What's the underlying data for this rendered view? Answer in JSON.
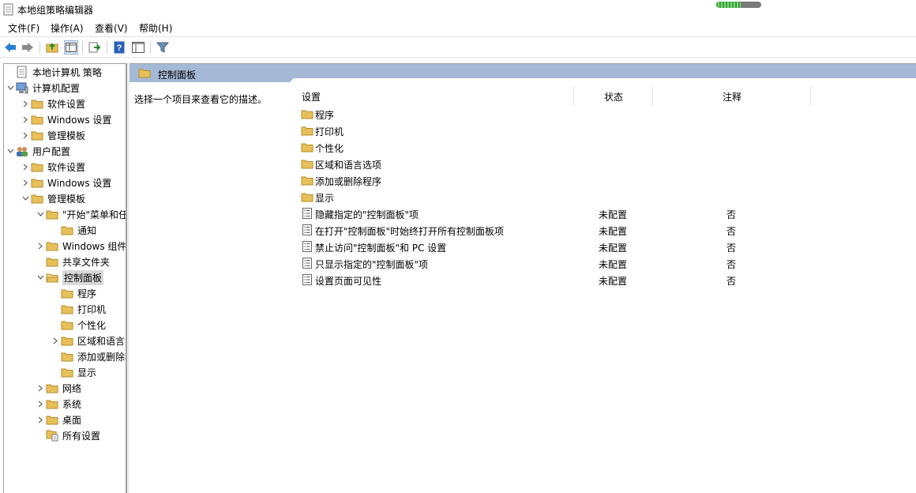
{
  "window": {
    "title": "本地组策略编辑器",
    "progress": 0.55
  },
  "menu": [
    {
      "label": "文件(F)"
    },
    {
      "label": "操作(A)"
    },
    {
      "label": "查看(V)"
    },
    {
      "label": "帮助(H)"
    }
  ],
  "toolbar": {
    "buttons": [
      "back-icon",
      "forward-icon",
      "up-folder-icon",
      "show-hide-tree-icon",
      "export-list-icon",
      "help-icon",
      "properties-icon",
      "filter-icon"
    ]
  },
  "tree": [
    {
      "label": "本地计算机 策略",
      "icon": "policy-icon",
      "chev": ""
    },
    {
      "label": "计算机配置",
      "icon": "computer-icon",
      "chev": "v"
    },
    {
      "label": "软件设置",
      "icon": "folder-icon",
      "chev": ">"
    },
    {
      "label": "Windows 设置",
      "icon": "folder-icon",
      "chev": ">"
    },
    {
      "label": "管理模板",
      "icon": "folder-icon",
      "chev": ">"
    },
    {
      "label": "用户配置",
      "icon": "users-icon",
      "chev": "v"
    },
    {
      "label": "软件设置",
      "icon": "folder-icon",
      "chev": ">"
    },
    {
      "label": "Windows 设置",
      "icon": "folder-icon",
      "chev": ">"
    },
    {
      "label": "管理模板",
      "icon": "folder-icon",
      "chev": "v"
    },
    {
      "label": "\"开始\"菜单和任务栏",
      "icon": "folder-icon",
      "chev": "v"
    },
    {
      "label": "通知",
      "icon": "folder-icon",
      "chev": ""
    },
    {
      "label": "Windows 组件",
      "icon": "folder-icon",
      "chev": ">"
    },
    {
      "label": "共享文件夹",
      "icon": "folder-icon",
      "chev": ""
    },
    {
      "label": "控制面板",
      "icon": "folder-open-icon",
      "chev": "v"
    },
    {
      "label": "程序",
      "icon": "folder-icon",
      "chev": ""
    },
    {
      "label": "打印机",
      "icon": "folder-icon",
      "chev": ""
    },
    {
      "label": "个性化",
      "icon": "folder-icon",
      "chev": ""
    },
    {
      "label": "区域和语言选项",
      "icon": "folder-icon",
      "chev": ">"
    },
    {
      "label": "添加或删除程序",
      "icon": "folder-icon",
      "chev": ""
    },
    {
      "label": "显示",
      "icon": "folder-icon",
      "chev": ""
    },
    {
      "label": "网络",
      "icon": "folder-icon",
      "chev": ">"
    },
    {
      "label": "系统",
      "icon": "folder-icon",
      "chev": ">"
    },
    {
      "label": "桌面",
      "icon": "folder-icon",
      "chev": ">"
    },
    {
      "label": "所有设置",
      "icon": "all-settings-icon",
      "chev": ""
    }
  ],
  "right": {
    "header_title": "控制面板",
    "description": "选择一个项目来查看它的描述。",
    "columns": {
      "setting": "设置",
      "state": "状态",
      "note": "注释"
    },
    "rows": [
      {
        "name": "程序",
        "state": "",
        "note": "",
        "icon": "folder-icon"
      },
      {
        "name": "打印机",
        "state": "",
        "note": "",
        "icon": "folder-icon"
      },
      {
        "name": "个性化",
        "state": "",
        "note": "",
        "icon": "folder-icon"
      },
      {
        "name": "区域和语言选项",
        "state": "",
        "note": "",
        "icon": "folder-icon"
      },
      {
        "name": "添加或删除程序",
        "state": "",
        "note": "",
        "icon": "folder-icon"
      },
      {
        "name": "显示",
        "state": "",
        "note": "",
        "icon": "folder-icon"
      },
      {
        "name": "隐藏指定的\"控制面板\"项",
        "state": "未配置",
        "note": "否",
        "icon": "policy-setting-icon"
      },
      {
        "name": "在打开\"控制面板\"时始终打开所有控制面板项",
        "state": "未配置",
        "note": "否",
        "icon": "policy-setting-icon"
      },
      {
        "name": "禁止访问\"控制面板\"和 PC 设置",
        "state": "未配置",
        "note": "否",
        "icon": "policy-setting-icon"
      },
      {
        "name": "只显示指定的\"控制面板\"项",
        "state": "未配置",
        "note": "否",
        "icon": "policy-setting-icon"
      },
      {
        "name": "设置页面可见性",
        "state": "未配置",
        "note": "否",
        "icon": "policy-setting-icon"
      }
    ]
  },
  "colors": {
    "header_band": "#a5b8d5",
    "folder": "#e8c05a",
    "selected": "#d9d9d9"
  }
}
